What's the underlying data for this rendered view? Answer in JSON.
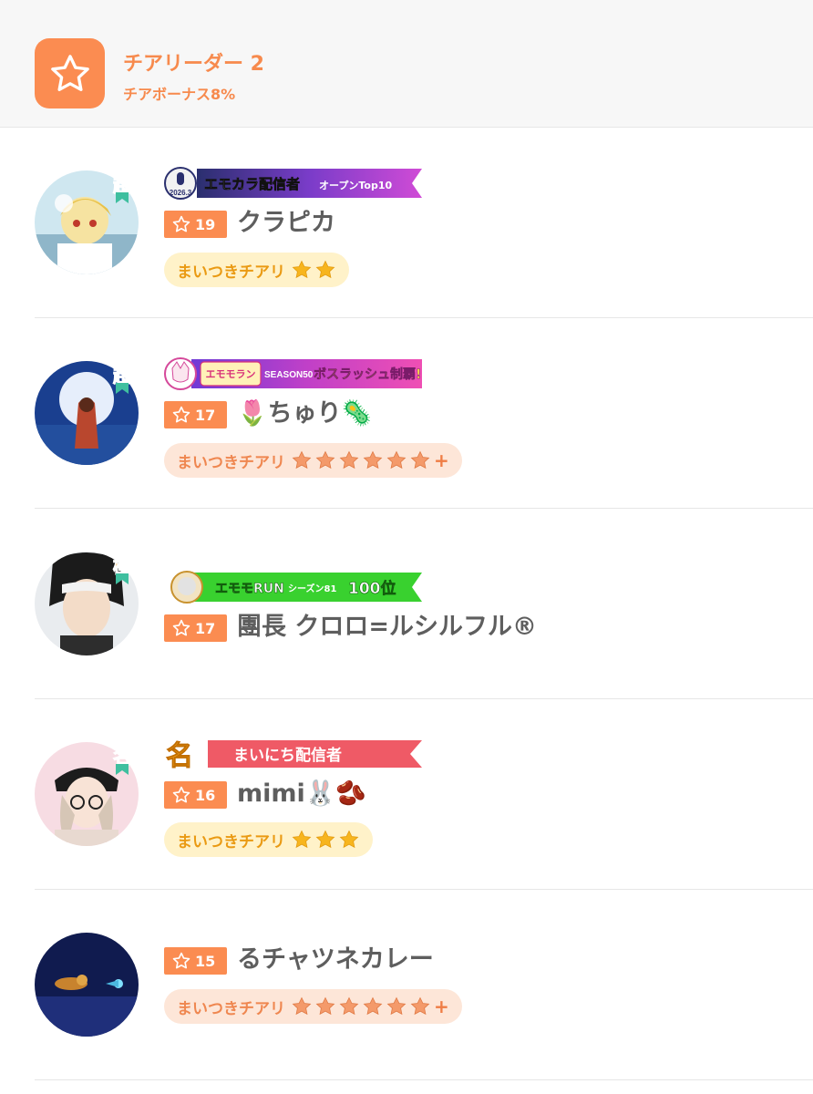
{
  "header": {
    "title": "チアリーダー 2",
    "subtitle": "チアボーナス8%",
    "icon": "star-icon",
    "accent_color": "#fb8c51"
  },
  "users": [
    {
      "rank_char": "超",
      "banner": {
        "year": "2026.3",
        "title": "エモカラ配信者",
        "suffix": "オープンTop10"
      },
      "score": "19",
      "name": "クラピカ",
      "badge": {
        "label": "まいつきチアリ",
        "stars": 2,
        "style": "gold"
      }
    },
    {
      "rank_char": "超",
      "banner": {
        "logo": "エモモラン",
        "season": "SEASON50",
        "title": "ボスラッシュ制覇!"
      },
      "score": "17",
      "name": "🌷ちゅり🦠",
      "badge": {
        "label": "まいつきチアリ",
        "stars": 6,
        "plus": "+",
        "style": "peach"
      }
    },
    {
      "rank_char": "極",
      "banner": {
        "title": "エモモRUN",
        "season": "シーズン81",
        "rank": "100位"
      },
      "score": "17",
      "name": "團長 クロロ=ルシルフル®"
    },
    {
      "rank_char": "名",
      "banner": {
        "mark": "名",
        "title": "まいにち配信者"
      },
      "score": "16",
      "name": "mimi🐰🫘",
      "badge": {
        "label": "まいつきチアリ",
        "stars": 3,
        "style": "gold"
      }
    },
    {
      "score": "15",
      "name": "るチャツネカレー",
      "badge": {
        "label": "まいつきチアリ",
        "stars": 6,
        "plus": "+",
        "style": "peach"
      }
    }
  ]
}
